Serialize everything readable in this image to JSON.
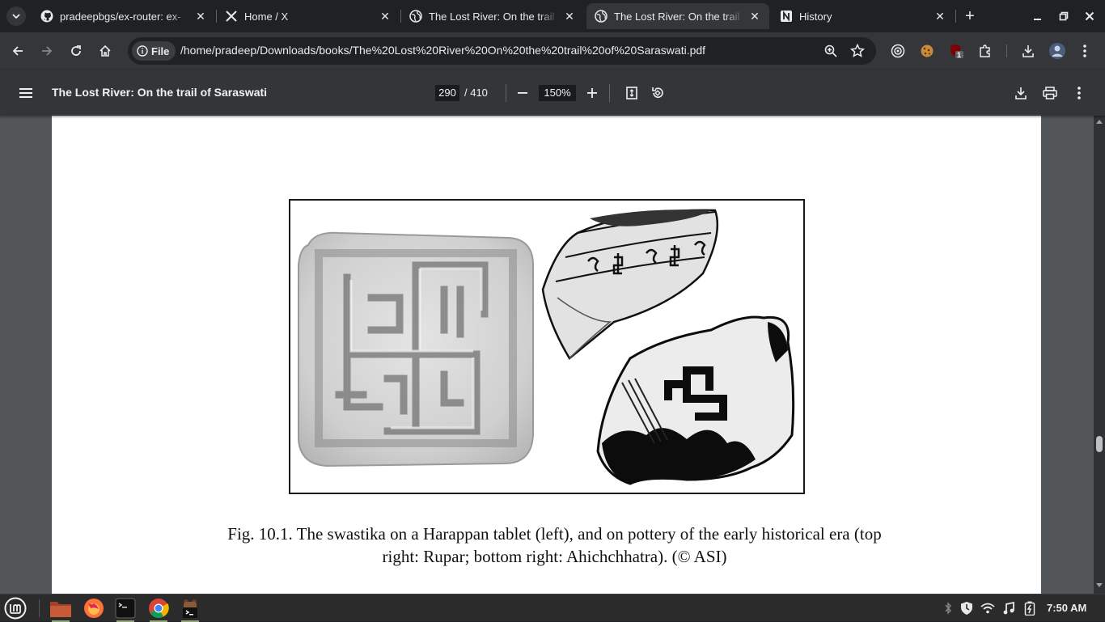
{
  "tabs": [
    {
      "title": "pradeepbgs/ex-router: ex-",
      "favicon": "github-icon",
      "active": false
    },
    {
      "title": "Home / X",
      "favicon": "x-logo-icon",
      "active": false
    },
    {
      "title": "The Lost River: On the trail",
      "favicon": "globe-icon",
      "active": false
    },
    {
      "title": "The Lost River: On the trail",
      "favicon": "globe-icon",
      "active": true
    },
    {
      "title": "History",
      "favicon": "notion-icon",
      "active": false
    }
  ],
  "omnibox": {
    "scheme_chip": "File",
    "url": "/home/pradeep/Downloads/books/The%20Lost%20River%20On%20the%20trail%20of%20Saraswati.pdf"
  },
  "extensions": {
    "badge_count": "1"
  },
  "pdf": {
    "title": "The Lost River: On the trail of Saraswati",
    "current_page": "290",
    "page_total": "/ 410",
    "zoom": "150%"
  },
  "document": {
    "caption_line1": "Fig. 10.1. The swastika on a Harappan tablet (left), and on pottery of the early historical era (top",
    "caption_line2": "right: Rupar; bottom right: Ahichchhatra). (© ASI)"
  },
  "taskbar": {
    "clock": "7:50 AM"
  },
  "colors": {
    "tabstrip": "#202124",
    "toolbar": "#35363a",
    "pdf_toolbar": "#323639",
    "viewer_bg": "#525659",
    "taskbar": "#2b2b2b"
  }
}
